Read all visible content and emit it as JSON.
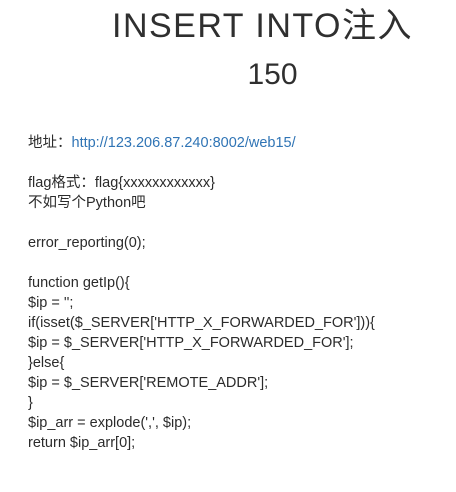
{
  "title": {
    "line1": "INSERT INTO注入",
    "line2": "150"
  },
  "address": {
    "label": "地址：",
    "url": "http://123.206.87.240:8002/web15/"
  },
  "flag": {
    "format_line": "flag格式：flag{xxxxxxxxxxxx}",
    "hint_line": "不如写个Python吧"
  },
  "code": {
    "error_line": "error_reporting(0);",
    "lines": [
      "function getIp(){",
      "$ip = '';",
      "if(isset($_SERVER['HTTP_X_FORWARDED_FOR'])){",
      "$ip = $_SERVER['HTTP_X_FORWARDED_FOR'];",
      "}else{",
      "$ip = $_SERVER['REMOTE_ADDR'];",
      "}",
      "$ip_arr = explode(',', $ip);",
      "return $ip_arr[0];"
    ]
  }
}
